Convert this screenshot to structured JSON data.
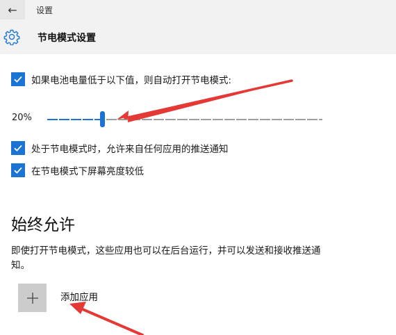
{
  "header": {
    "back_symbol": "←",
    "app_title": "设置",
    "page_icon": "gear-icon",
    "page_title": "节电模式设置"
  },
  "settings": {
    "auto_saver": {
      "checked": true,
      "label": "如果电池电量低于以下值，则自动打开节电模式:"
    },
    "threshold": {
      "value_text": "20%",
      "percent": 20
    },
    "push_notifications": {
      "checked": true,
      "label": "处于节电模式时，允许来自任何应用的推送通知"
    },
    "lower_brightness": {
      "checked": true,
      "label": "在节电模式下屏幕亮度较低"
    }
  },
  "always_allowed": {
    "title": "始终允许",
    "description": "即使打开节电模式，这些应用也可以在后台运行，并可以发送和接收推送通知。",
    "add_app_icon": "plus-icon",
    "add_app_label": "添加应用"
  },
  "colors": {
    "accent": "#1b73d3",
    "header_bg": "#f2f2f2",
    "track_inactive": "#9e9e9e",
    "tile_bg": "#cccccc",
    "annotation": "#e53935"
  }
}
